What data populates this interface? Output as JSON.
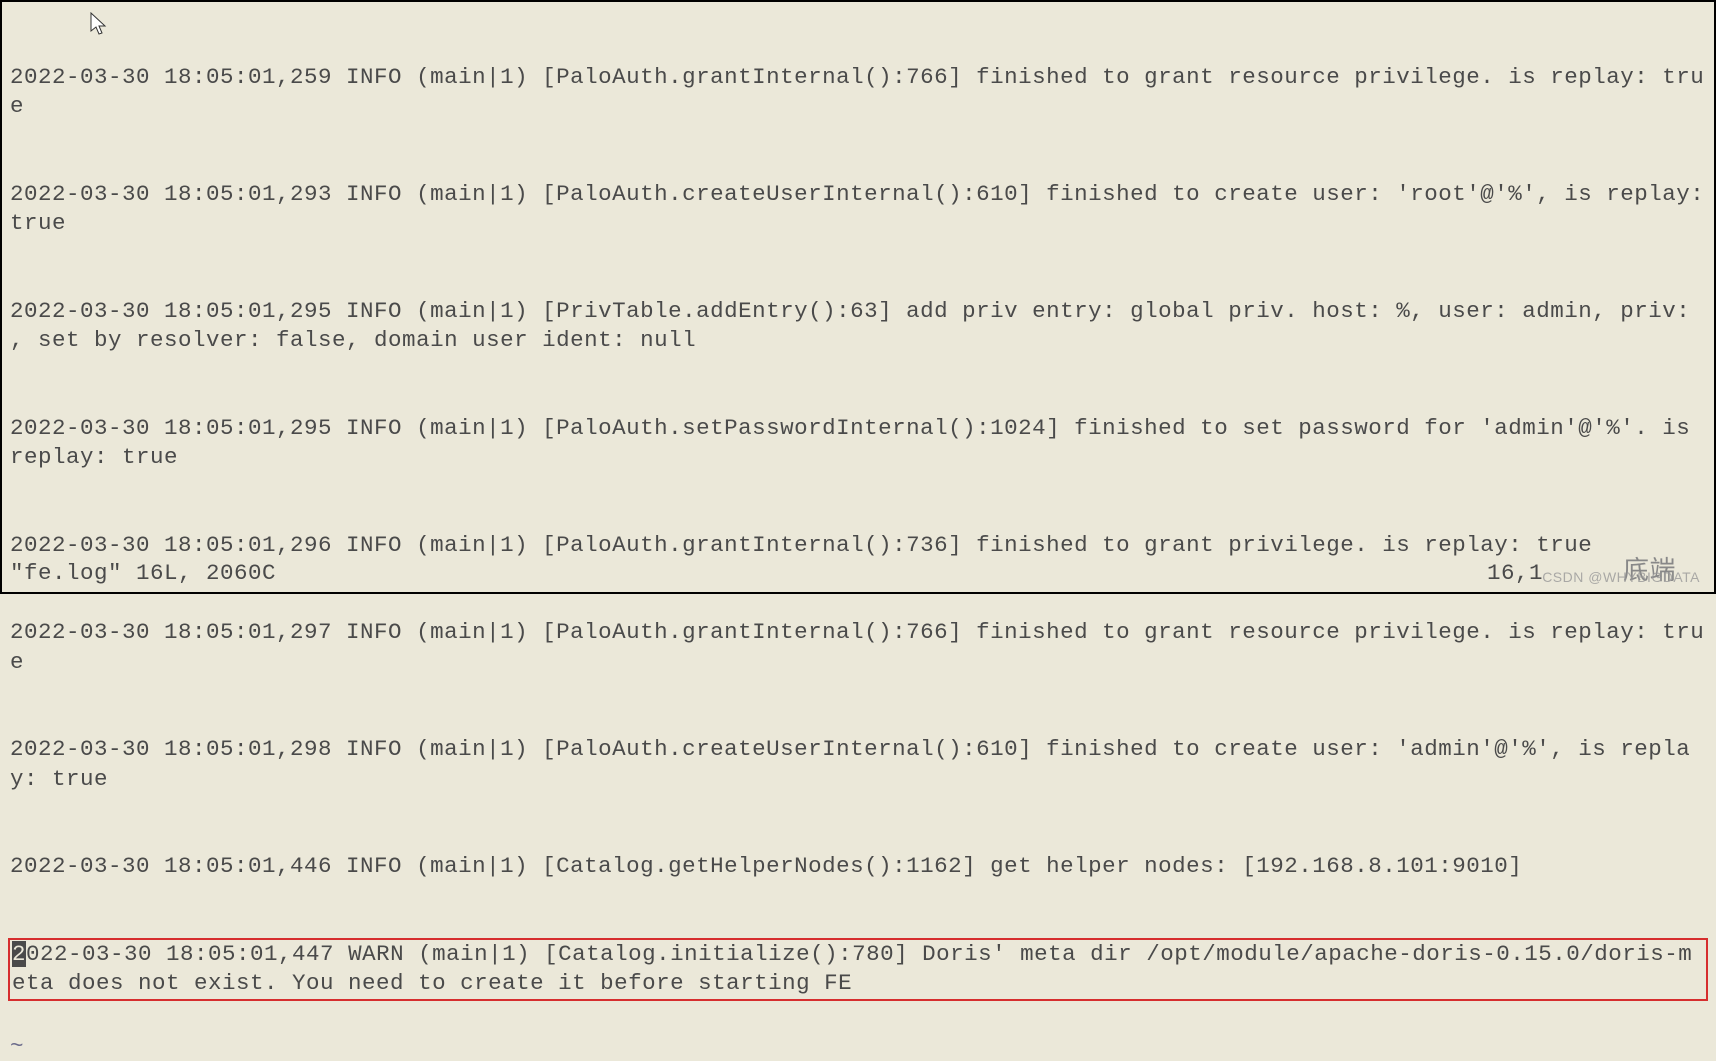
{
  "logs": [
    "2022-03-30 18:05:01,259 INFO (main|1) [PaloAuth.grantInternal():766] finished to grant resource privilege. is replay: true",
    "2022-03-30 18:05:01,293 INFO (main|1) [PaloAuth.createUserInternal():610] finished to create user: 'root'@'%', is replay: true",
    "2022-03-30 18:05:01,295 INFO (main|1) [PrivTable.addEntry():63] add priv entry: global priv. host: %, user: admin, priv: , set by resolver: false, domain user ident: null",
    "2022-03-30 18:05:01,295 INFO (main|1) [PaloAuth.setPasswordInternal():1024] finished to set password for 'admin'@'%'. is replay: true",
    "2022-03-30 18:05:01,296 INFO (main|1) [PaloAuth.grantInternal():736] finished to grant privilege. is replay: true",
    "2022-03-30 18:05:01,297 INFO (main|1) [PaloAuth.grantInternal():766] finished to grant resource privilege. is replay: true",
    "2022-03-30 18:05:01,298 INFO (main|1) [PaloAuth.createUserInternal():610] finished to create user: 'admin'@'%', is replay: true",
    "2022-03-30 18:05:01,446 INFO (main|1) [Catalog.getHelperNodes():1162] get helper nodes: [192.168.8.101:9010]"
  ],
  "highlighted_log": "2022-03-30 18:05:01,447 WARN (main|1) [Catalog.initialize():780] Doris' meta dir /opt/module/apache-doris-0.15.0/doris-meta does not exist. You need to create it before starting FE",
  "tilde": "~",
  "status": {
    "file_info": "\"fe.log\" 16L, 2060C",
    "position": "16,1",
    "end_label": "底端"
  },
  "watermark": "CSDN @WHYBIGDATA"
}
